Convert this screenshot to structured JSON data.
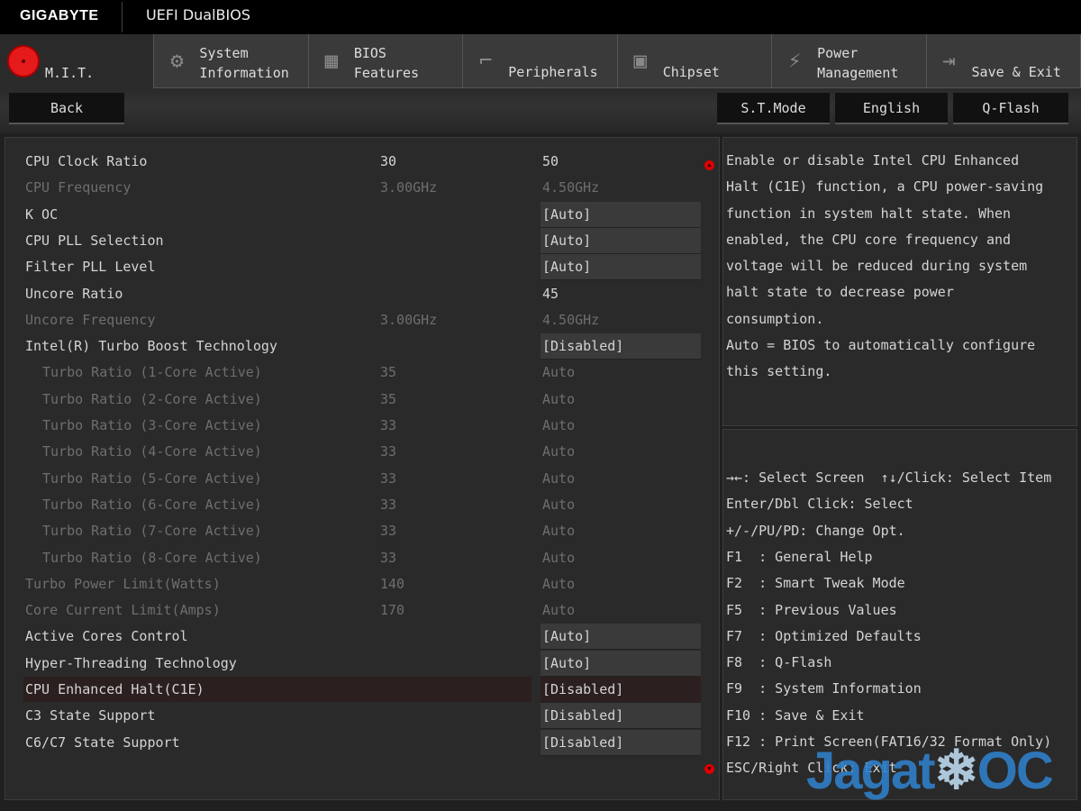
{
  "header": {
    "brand": "GIGABYTE",
    "product": "UEFI DualBIOS"
  },
  "tabs": [
    {
      "label1": "",
      "label2": "M.I.T.",
      "icon": "mit-icon",
      "active": true
    },
    {
      "label1": "System",
      "label2": "Information",
      "icon": "gear-icon"
    },
    {
      "label1": "BIOS",
      "label2": "Features",
      "icon": "bios-chip-icon"
    },
    {
      "label1": "",
      "label2": "Peripherals",
      "icon": "peripherals-icon"
    },
    {
      "label1": "",
      "label2": "Chipset",
      "icon": "chipset-icon"
    },
    {
      "label1": "Power",
      "label2": "Management",
      "icon": "power-icon"
    },
    {
      "label1": "",
      "label2": "Save & Exit",
      "icon": "exit-icon"
    }
  ],
  "toolbar": {
    "back": "Back",
    "st_mode": "S.T.Mode",
    "language": "English",
    "qflash": "Q-Flash"
  },
  "settings": [
    {
      "label": "CPU Clock Ratio",
      "current": "30",
      "value": "50"
    },
    {
      "label": "CPU Frequency",
      "current": "3.00GHz",
      "value": "4.50GHz",
      "disabled": true
    },
    {
      "label": "K OC",
      "current": "",
      "value": "[Auto]",
      "box": true
    },
    {
      "label": "CPU PLL Selection",
      "current": "",
      "value": "[Auto]",
      "box": true
    },
    {
      "label": "Filter PLL Level",
      "current": "",
      "value": "[Auto]",
      "box": true
    },
    {
      "label": "Uncore Ratio",
      "current": "",
      "value": "45"
    },
    {
      "label": "Uncore Frequency",
      "current": "3.00GHz",
      "value": "4.50GHz",
      "disabled": true
    },
    {
      "label": "Intel(R) Turbo Boost Technology",
      "current": "",
      "value": "[Disabled]",
      "box": true
    },
    {
      "label": "Turbo Ratio (1-Core Active)",
      "current": "35",
      "value": "Auto",
      "disabled": true,
      "indent": true
    },
    {
      "label": "Turbo Ratio (2-Core Active)",
      "current": "35",
      "value": "Auto",
      "disabled": true,
      "indent": true
    },
    {
      "label": "Turbo Ratio (3-Core Active)",
      "current": "33",
      "value": "Auto",
      "disabled": true,
      "indent": true
    },
    {
      "label": "Turbo Ratio (4-Core Active)",
      "current": "33",
      "value": "Auto",
      "disabled": true,
      "indent": true
    },
    {
      "label": "Turbo Ratio (5-Core Active)",
      "current": "33",
      "value": "Auto",
      "disabled": true,
      "indent": true
    },
    {
      "label": "Turbo Ratio (6-Core Active)",
      "current": "33",
      "value": "Auto",
      "disabled": true,
      "indent": true
    },
    {
      "label": "Turbo Ratio (7-Core Active)",
      "current": "33",
      "value": "Auto",
      "disabled": true,
      "indent": true
    },
    {
      "label": "Turbo Ratio (8-Core Active)",
      "current": "33",
      "value": "Auto",
      "disabled": true,
      "indent": true
    },
    {
      "label": "Turbo Power Limit(Watts)",
      "current": "140",
      "value": "Auto",
      "disabled": true
    },
    {
      "label": "Core Current Limit(Amps)",
      "current": "170",
      "value": "Auto",
      "disabled": true
    },
    {
      "label": "Active Cores Control",
      "current": "",
      "value": "[Auto]",
      "box": true
    },
    {
      "label": "Hyper-Threading Technology",
      "current": "",
      "value": "[Auto]",
      "box": true
    },
    {
      "label": "CPU Enhanced Halt(C1E)",
      "current": "",
      "value": "[Disabled]",
      "box": true,
      "selected": true
    },
    {
      "label": "C3 State Support",
      "current": "",
      "value": "[Disabled]",
      "box": true
    },
    {
      "label": "C6/C7 State Support",
      "current": "",
      "value": "[Disabled]",
      "box": true
    }
  ],
  "description": "Enable or disable Intel CPU Enhanced\nHalt (C1E) function, a CPU power-saving\nfunction in system halt state. When\nenabled, the CPU core frequency and\nvoltage will be reduced during system\nhalt state to decrease power\nconsumption.\nAuto = BIOS to automatically configure\nthis setting.",
  "keys": [
    "→←: Select Screen  ↑↓/Click: Select Item",
    "Enter/Dbl Click: Select",
    "+/-/PU/PD: Change Opt.",
    "F1  : General Help",
    "F2  : Smart Tweak Mode",
    "F5  : Previous Values",
    "F7  : Optimized Defaults",
    "F8  : Q-Flash",
    "F9  : System Information",
    "F10 : Save & Exit",
    "F12 : Print Screen(FAT16/32 Format Only)",
    "ESC/Right Click: Exit"
  ],
  "watermark": "JagatOC",
  "colors": {
    "accent": "#e51b1b",
    "selected_row": "#2c1f1f"
  }
}
